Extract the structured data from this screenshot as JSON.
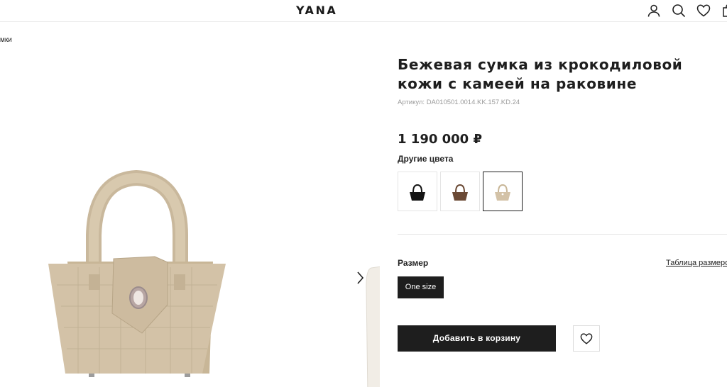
{
  "header": {
    "logo": "YANA",
    "icons": [
      "user-icon",
      "search-icon",
      "heart-icon",
      "bag-icon"
    ]
  },
  "breadcrumb": {
    "current": "мки"
  },
  "gallery": {
    "next_icon": "chevron-right-icon"
  },
  "product": {
    "title": "Бежевая сумка из крокодиловой кожи с камеей на раковине",
    "sku_label": "Артикул: DA010501.0014.KK.157.KD.24",
    "price": "1 190 000 ₽",
    "other_colors_label": "Другие цвета",
    "swatches": [
      {
        "color": "#141414"
      },
      {
        "color": "#6b4a35"
      },
      {
        "color": "#d3c2a7",
        "active": true
      }
    ],
    "size_label": "Размер",
    "size_table_link": "Таблица размеров",
    "sizes": [
      "One size"
    ],
    "add_to_cart": "Добавить в корзину"
  },
  "colors": {
    "primary": "#1e1e1e",
    "bag_beige": "#d3c2a7"
  }
}
